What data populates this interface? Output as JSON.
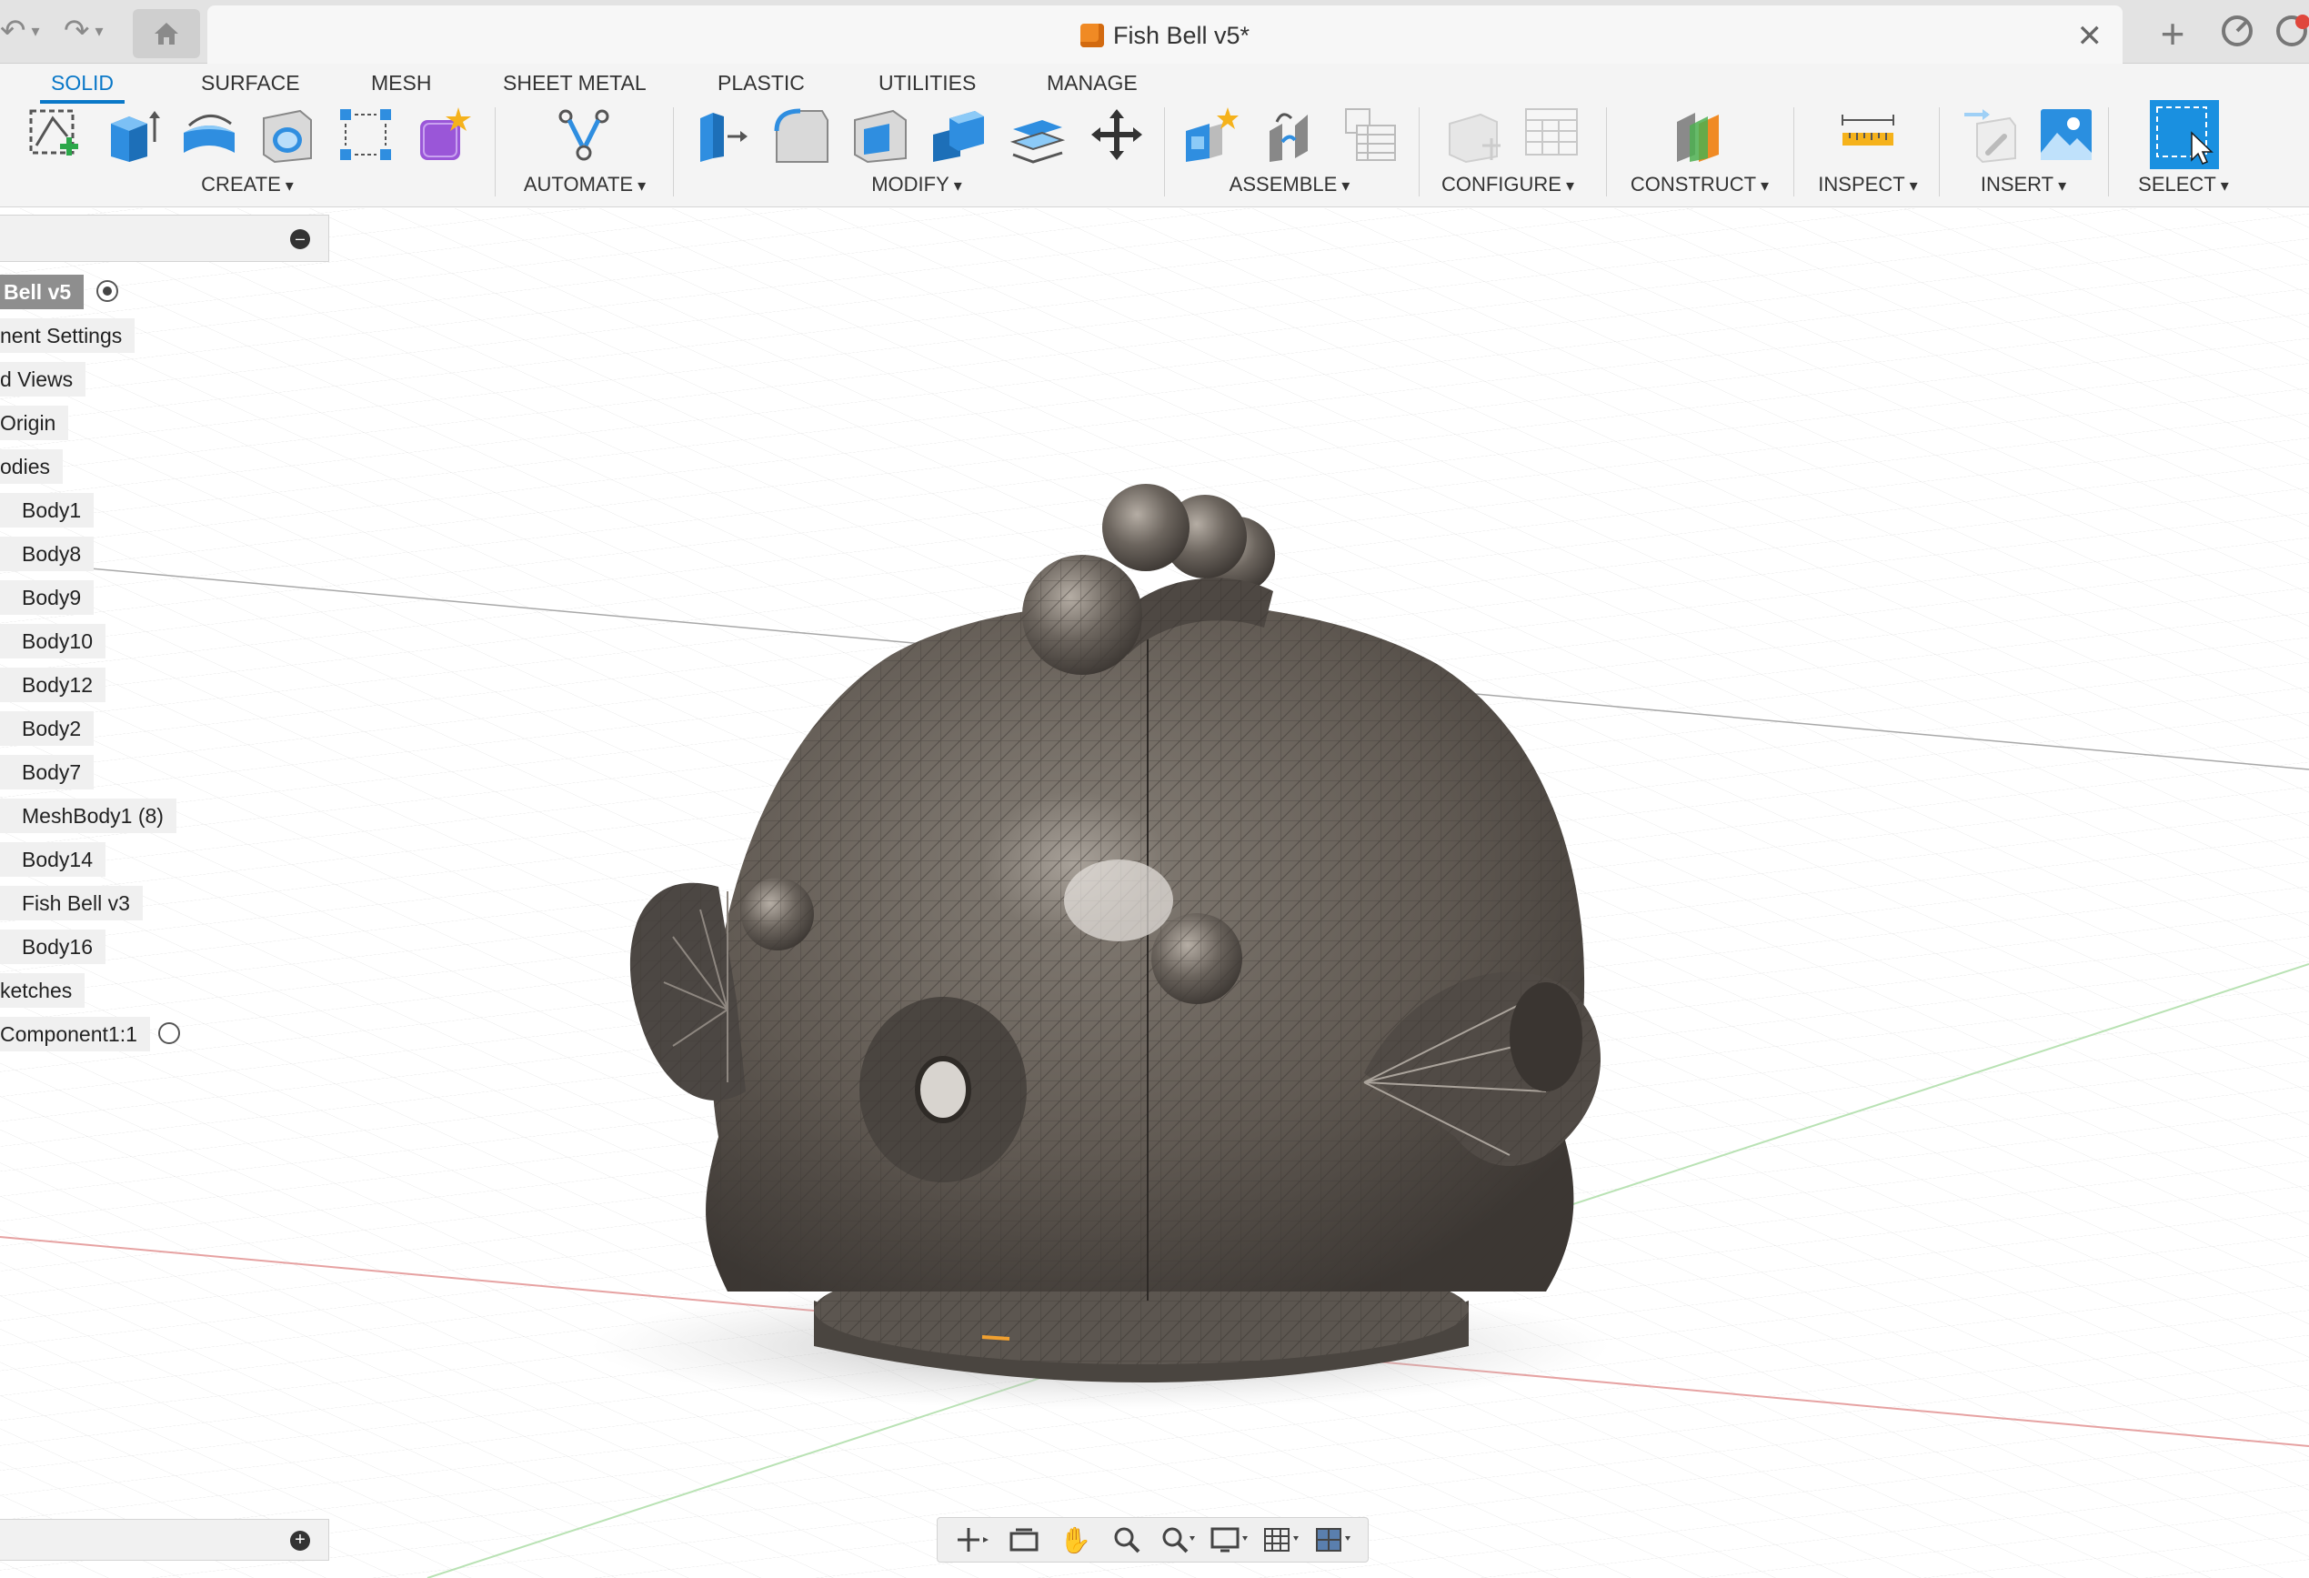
{
  "window": {
    "title": "Fish Bell v5*"
  },
  "workspace_tabs": [
    "SOLID",
    "SURFACE",
    "MESH",
    "SHEET METAL",
    "PLASTIC",
    "UTILITIES",
    "MANAGE"
  ],
  "active_tab": "SOLID",
  "groups": {
    "create": "CREATE",
    "automate": "AUTOMATE",
    "modify": "MODIFY",
    "assemble": "ASSEMBLE",
    "configure": "CONFIGURE",
    "construct": "CONSTRUCT",
    "inspect": "INSPECT",
    "insert": "INSERT",
    "select": "SELECT"
  },
  "browser": {
    "root": "Bell v5",
    "items": [
      "nent Settings",
      "d Views",
      "Origin",
      "odies",
      "Body1",
      "Body8",
      "Body9",
      "Body10",
      "Body12",
      "Body2",
      "Body7",
      "MeshBody1 (8)",
      "Body14",
      "Fish Bell v3",
      "Body16",
      "ketches",
      "Component1:1"
    ]
  },
  "colors": {
    "accent": "#0a78c8",
    "ribbon_bg": "#f4f4f4",
    "model": "#6e6760",
    "select_blue": "#1a90e0"
  },
  "icons": {
    "undo": "undo-icon",
    "redo": "redo-icon",
    "home": "home-icon",
    "close": "close-icon",
    "add": "plus-icon"
  }
}
